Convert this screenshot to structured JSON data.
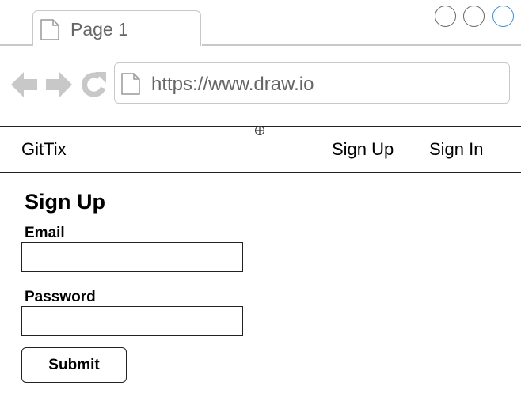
{
  "browser": {
    "tab": {
      "title": "Page 1",
      "icon": "page-icon"
    },
    "window_controls": [
      "minimize-icon",
      "maximize-icon",
      "close-icon"
    ],
    "nav": {
      "icons": [
        "back-arrow-icon",
        "forward-arrow-icon",
        "reload-icon"
      ]
    },
    "address_bar": {
      "url": "https://www.draw.io",
      "icon": "page-icon"
    }
  },
  "app": {
    "brand": "GitTix",
    "nav_links": {
      "sign_up": "Sign Up",
      "sign_in": "Sign In"
    }
  },
  "form": {
    "title": "Sign Up",
    "email_label": "Email",
    "email_value": "",
    "password_label": "Password",
    "password_value": "",
    "submit_label": "Submit"
  },
  "colors": {
    "chrome_gray": "#c8c8c8",
    "text_gray": "#666666",
    "active_blue": "#3d8fd6",
    "ink": "#222222"
  }
}
